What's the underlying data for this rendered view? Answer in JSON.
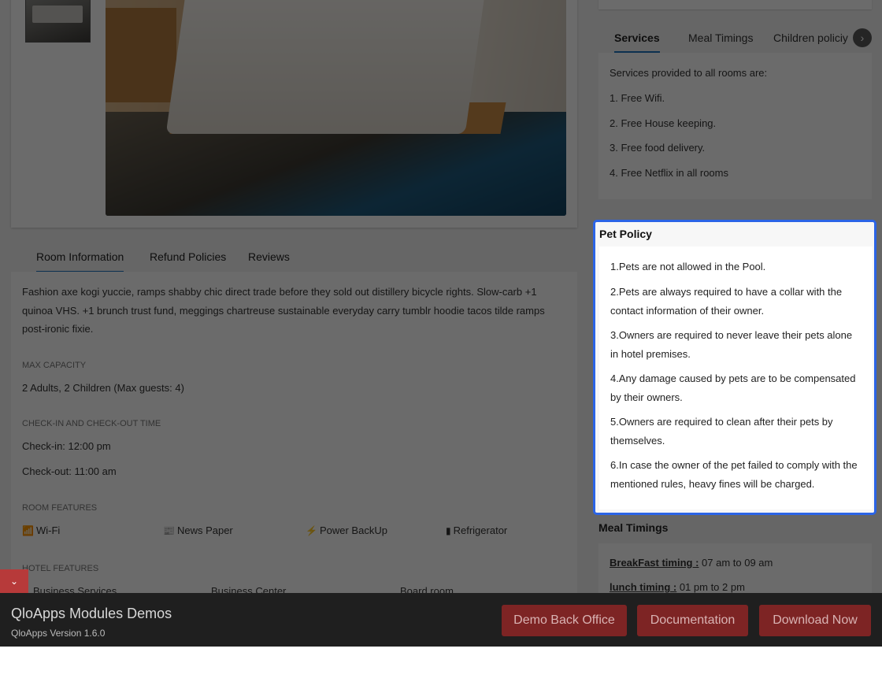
{
  "room_tabs": [
    "Room Information",
    "Refund Policies",
    "Reviews"
  ],
  "room_info": {
    "description": "Fashion axe kogi yuccie, ramps shabby chic direct trade before they sold out distillery bicycle rights. Slow-carb +1 quinoa VHS. +1 brunch trust fund, meggings chartreuse sustainable everyday carry tumblr hoodie tacos tilde ramps post-ironic fixie.",
    "max_capacity_label": "MAX CAPACITY",
    "max_capacity_value": "2 Adults, 2 Children (Max guests: 4)",
    "checkin_label": "CHECK-IN AND CHECK-OUT TIME",
    "checkin_value": "Check-in: 12:00 pm",
    "checkout_value": "Check-out: 11:00 am",
    "room_features_label": "ROOM FEATURES",
    "room_features": [
      {
        "label": "Wi-Fi",
        "icon": "wifi-icon"
      },
      {
        "label": "News Paper",
        "icon": "newspaper-icon"
      },
      {
        "label": "Power BackUp",
        "icon": "power-icon"
      },
      {
        "label": "Refrigerator",
        "icon": "fridge-icon"
      }
    ],
    "hotel_features_label": "HOTEL FEATURES",
    "hotel_features": [
      "Business Services",
      "Business Center",
      "Board room"
    ]
  },
  "policy_tabs": [
    "Services",
    "Meal Timings",
    "Children policiy"
  ],
  "services": {
    "intro": "Services provided to all rooms are:",
    "items": [
      "1. Free Wifi.",
      "2. Free House keeping.",
      "3. Free food delivery.",
      "4. Free Netflix in all rooms"
    ]
  },
  "pet_policy": {
    "title": "Pet Policy",
    "items": [
      "1.Pets are not allowed in the Pool.",
      "2.Pets are always required to have a collar with the contact information of their owner.",
      "3.Owners are required to never leave their pets alone in hotel premises.",
      "4.Any damage caused by pets are to be compensated by their owners.",
      "5.Owners are required to clean after their pets by themselves.",
      "6.In case the owner of the pet failed to comply with the mentioned rules, heavy fines will be charged."
    ]
  },
  "meal_timings": {
    "title": "Meal Timings",
    "breakfast_label": "BreakFast timing :",
    "breakfast_value": " 07 am to 09 am",
    "lunch_label": "lunch timing :",
    "lunch_value": " 01 pm to 2 pm"
  },
  "footer": {
    "title": "QloApps Modules Demos",
    "version": "QloApps Version 1.6.0",
    "buttons": [
      "Demo Back Office",
      "Documentation",
      "Download Now"
    ]
  },
  "colors": {
    "accent_blue": "#2b64e6",
    "tab_underline": "#1e73be",
    "footer_bg": "#1f1f1f",
    "button_red": "#b73a3a"
  }
}
